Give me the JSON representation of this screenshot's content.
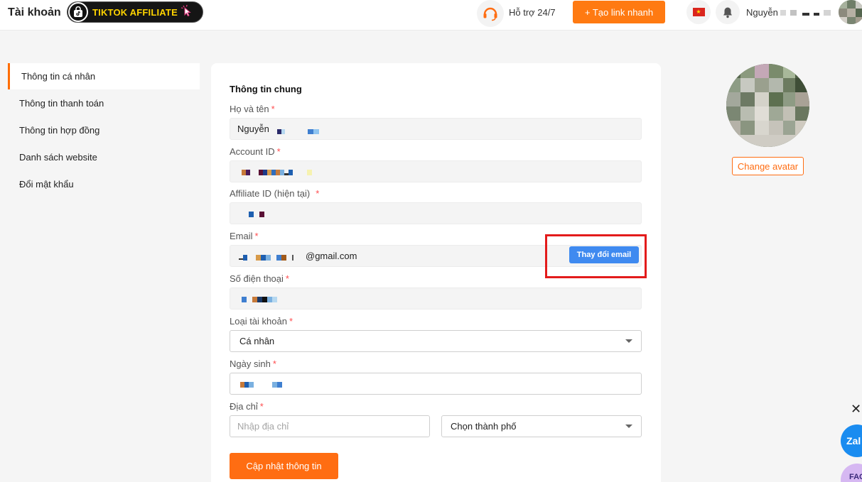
{
  "header": {
    "title": "Tài khoản",
    "badge_label": "TIKTOK AFFILIATE",
    "support_label": "Hỗ trợ 24/7",
    "create_link_label": "+ Tạo link nhanh",
    "user_name": "Nguyễn",
    "flag": "vietnam-flag-icon"
  },
  "sidebar": {
    "items": [
      {
        "label": "Thông tin cá nhân",
        "active": true
      },
      {
        "label": "Thông tin thanh toán"
      },
      {
        "label": "Thông tin hợp đồng"
      },
      {
        "label": "Danh sách website"
      },
      {
        "label": "Đổi mật khẩu"
      }
    ]
  },
  "form": {
    "section_title": "Thông tin chung",
    "required_mark": "*",
    "full_name": {
      "label": "Họ và tên",
      "value": "Nguyễn"
    },
    "account_id": {
      "label": "Account ID"
    },
    "affiliate_id": {
      "label": "Affiliate ID (hiện tại)"
    },
    "email": {
      "label": "Email",
      "value": "@gmail.com",
      "change_button": "Thay đổi email"
    },
    "phone": {
      "label": "Số điện thoại"
    },
    "account_type": {
      "label": "Loại tài khoản",
      "value": "Cá nhân"
    },
    "birthday": {
      "label": "Ngày sinh"
    },
    "address": {
      "label": "Địa chỉ",
      "placeholder": "Nhập địa chỉ",
      "city_value": "Chọn thành phố"
    },
    "submit_label": "Cập nhật thông tin"
  },
  "profile": {
    "change_avatar_label": "Change avatar"
  },
  "floating": {
    "close_symbol": "✕",
    "zalo_label": "Zal",
    "facebook_label": "FAC"
  },
  "colors": {
    "accent": "#ff6d12",
    "email_button": "#3f8af0",
    "highlight_frame": "#e31b1b"
  }
}
